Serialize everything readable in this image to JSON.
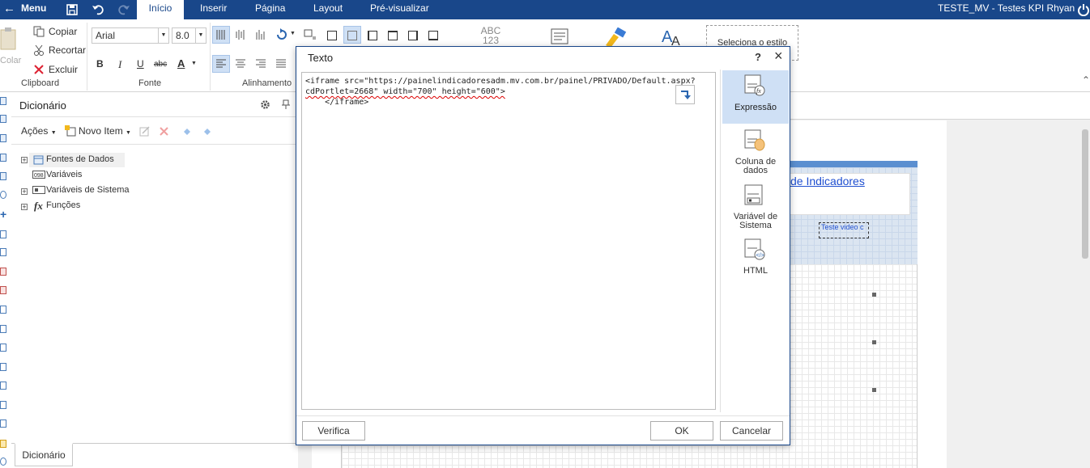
{
  "topbar": {
    "menu_label": "Menu",
    "tabs": [
      "Início",
      "Inserir",
      "Página",
      "Layout",
      "Pré-visualizar"
    ],
    "user_label": "TESTE_MV - Testes KPI Rhyan",
    "bg_color": "#19478a"
  },
  "ribbon": {
    "clipboard": {
      "paste": "Colar",
      "copy": "Copiar",
      "cut": "Recortar",
      "delete": "Excluir",
      "group": "Clipboard"
    },
    "font": {
      "name": "Arial",
      "size": "8.0",
      "group": "Fonte",
      "bold": "B",
      "italic": "I",
      "underline": "U",
      "strike": "abc",
      "color": "A"
    },
    "alignment": {
      "group": "Alinhamento"
    },
    "style_box": "Seleciona o estilo",
    "abc_label": "ABC",
    "num_label": "123"
  },
  "dictionary": {
    "title": "Dicionário",
    "actions": "Ações",
    "new_item": "Novo Item",
    "tree": [
      "Fontes de Dados",
      "Variáveis",
      "Variáveis de Sistema",
      "Funções"
    ],
    "bottom_tab": "Dicionário"
  },
  "designer": {
    "link_text": "de Indicadores",
    "video_text": "Teste video c"
  },
  "dialog": {
    "title": "Texto",
    "help": "?",
    "close": "×",
    "code_line1": "<iframe src=\"https://painelindicadoresadm.mv.com.br/painel/PRIVADO/Default.aspx?",
    "code_line2": "cdPortlet=2668\" width=\"700\" height=\"600\">",
    "code_line3": "    </iframe>",
    "side": [
      {
        "label1": "Expressão",
        "label2": ""
      },
      {
        "label1": "Coluna de",
        "label2": "dados"
      },
      {
        "label1": "Variável de",
        "label2": "Sistema"
      },
      {
        "label1": "HTML",
        "label2": ""
      }
    ],
    "verify": "Verifica",
    "ok": "OK",
    "cancel": "Cancelar"
  }
}
